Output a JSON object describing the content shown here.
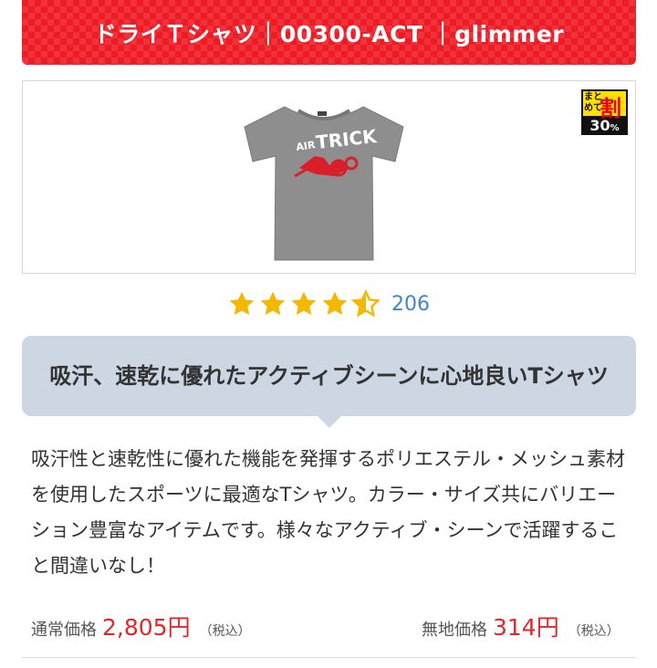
{
  "header": {
    "title": "ドライＴシャツ｜00300-ACT ｜glimmer",
    "bg_color": "#ee1b24"
  },
  "product_image": {
    "print_text": "AIR TRICK",
    "shirt_color": "#8e8e8e",
    "print_color": "#d81f2a"
  },
  "badge": {
    "line1": "まと",
    "line2": "めて",
    "kanji": "割",
    "percent": "30",
    "percent_unit": "%"
  },
  "rating": {
    "stars": 4.5,
    "count": "206",
    "star_color": "#f5b800"
  },
  "headline": "吸汗、速乾に優れたアクティブシーンに心地良いTシャツ",
  "description": "吸汗性と速乾性に優れた機能を発揮するポリエステル・メッシュ素材を使用したスポーツに最適なTシャツ。カラー・サイズ共にバリエーション豊富なアイテムです。様々なアクティブ・シーンで活躍すること間違いなし！",
  "prices": {
    "regular_label": "通常価格",
    "regular_value": "2,805円",
    "regular_tax": "（税込）",
    "plain_label": "無地価格",
    "plain_value": "314円",
    "plain_tax": "（税込）",
    "price_color": "#e3262b"
  }
}
